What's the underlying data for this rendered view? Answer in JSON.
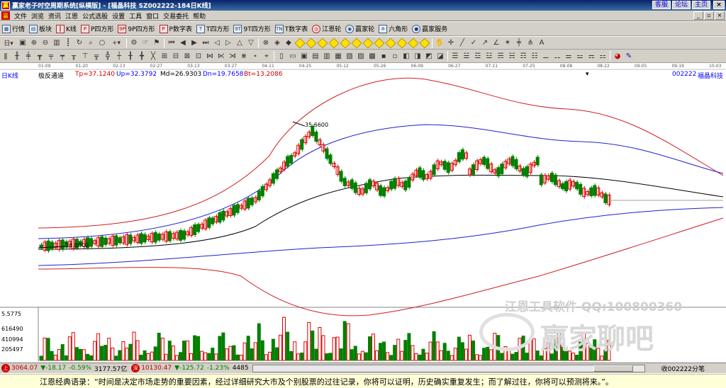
{
  "titlebar": {
    "title": "赢家老子时空周期系统[纵横版] - [福晶科技   SZ002222-184日K线]",
    "links": [
      "客服",
      "论坛",
      "主页"
    ],
    "close": "×"
  },
  "menubar": {
    "items": [
      "文件",
      "浏览",
      "资讯",
      "江恩",
      "公式选股",
      "设置",
      "工具",
      "窗口",
      "交易委托",
      "帮助"
    ]
  },
  "toolbar1": {
    "items": [
      {
        "icon": "grid-icon",
        "label": "行情"
      },
      {
        "icon": "blocks-icon",
        "label": "板块"
      },
      {
        "icon": "kline-icon",
        "label": "K线"
      },
      {
        "icon": "p-square-icon",
        "label": "P四方形"
      },
      {
        "icon": "9p-square-icon",
        "label": "9P四方形"
      },
      {
        "icon": "p-table-icon",
        "label": "P数字表"
      },
      {
        "icon": "t-square-icon",
        "label": "T四方形"
      },
      {
        "icon": "9t-square-icon",
        "label": "9T四方形"
      },
      {
        "icon": "t-table-icon",
        "label": "T数字表"
      },
      {
        "icon": "gann-wheel-icon",
        "label": "江恩轮"
      },
      {
        "icon": "winner-wheel-icon",
        "label": "赢家轮"
      },
      {
        "icon": "hexagon-icon",
        "label": "六角形"
      },
      {
        "icon": "service-icon",
        "label": "赢家服务"
      }
    ]
  },
  "chart": {
    "period": "日K线",
    "stock_code": "002222",
    "stock_name": "福晶科技",
    "indicator_name": "极反通道",
    "tp": "Tp=37.1240",
    "up": "Up=32.3792",
    "md": "Md=26.9303",
    "dn": "Dn=19.7658",
    "bt": "Bt=13.2086",
    "dates": [
      "01-09",
      "01-20",
      "02-13",
      "02-27",
      "03-13",
      "03-27",
      "04-11",
      "04-25",
      "05-12",
      "05-26",
      "06-09",
      "06-27",
      "07-11",
      "07-25",
      "08-08",
      "08-22",
      "09-05",
      "09-19",
      "10-03"
    ],
    "high_label": "35.6600",
    "low_label": "16.0000",
    "vol_axis": [
      "5.5775",
      "616490",
      "410994",
      "205497"
    ],
    "colors": {
      "upper": "#d02020",
      "mid": "#2020d0",
      "center": "#000000",
      "up_candle": "#e00000",
      "down_candle": "#008000"
    }
  },
  "watermark": {
    "line1": "江恩工具软件  QQ:100800360",
    "line2": "赢家聊吧"
  },
  "statusbar": {
    "sh_index": "3064.07",
    "sh_change": "▼-18.17",
    "sh_pct": "-0.59%",
    "sh_amount": "3177.57亿",
    "sz_index": "10130.47",
    "sz_change": "▼-125.72",
    "sz_pct": "-1.23%",
    "sz_amount": "4485",
    "right_text": "收002222分笔"
  },
  "quote": {
    "text": "江恩经典语录：“时间是决定市场走势的重要因素，经过详细研究大市及个别股票的过往记录，你将可以证明，历史确实重复发生；而了解过往，你将可以预测将来。”。"
  }
}
